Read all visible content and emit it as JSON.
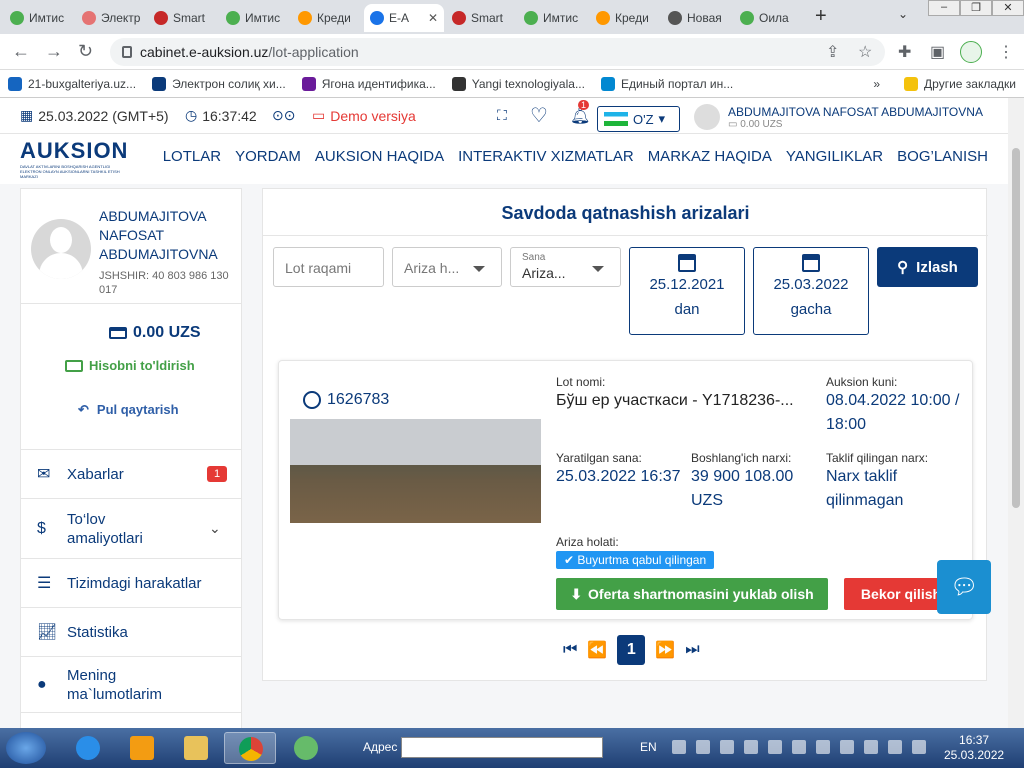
{
  "browser": {
    "tabs": [
      {
        "label": "Имтис",
        "color": "#4caf50"
      },
      {
        "label": "Электр",
        "color": "#e57373"
      },
      {
        "label": "Smart",
        "color": "#c62828"
      },
      {
        "label": "Имтис",
        "color": "#4caf50"
      },
      {
        "label": "Креди",
        "color": "#ff9800"
      },
      {
        "label": "E-A",
        "color": "#1a73e8",
        "active": true
      },
      {
        "label": "Smart",
        "color": "#c62828"
      },
      {
        "label": "Имтис",
        "color": "#4caf50"
      },
      {
        "label": "Креди",
        "color": "#ff9800"
      },
      {
        "label": "Новая",
        "color": "#555555"
      },
      {
        "label": "Оила",
        "color": "#4caf50"
      }
    ],
    "url_host": "cabinet.e-auksion.uz",
    "url_path": "/lot-application",
    "bookmarks": [
      {
        "label": "21-buxgalteriya.uz...",
        "color": "#1565c0"
      },
      {
        "label": "Электрон солиқ хи...",
        "color": "#0b3a7a"
      },
      {
        "label": "Ягона идентифика...",
        "color": "#6a1b9a"
      },
      {
        "label": "Yangi texnologiyala...",
        "color": "#333333"
      },
      {
        "label": "Единый портал ин...",
        "color": "#0288d1"
      }
    ],
    "bookmarks_more": "»",
    "other_bookmarks": "Другие закладки"
  },
  "topinfo": {
    "date": "25.03.2022 (GMT+5)",
    "time": "16:37:42",
    "demo": "Demo versiya",
    "notif_count": "1",
    "lang": "O'Z",
    "user_name": "ABDUMAJITOVA NAFOSAT ABDUMAJITOVNA",
    "user_balance": "0.00 UZS"
  },
  "logo": {
    "text": "AUKSION",
    "sub": "DAVLAT AKTIVLARINI BOSHQARISH AGENTLIGI ELEKTRON ONLAYN AUKSIONLARNI TASHKIL ETISH MARKAZI"
  },
  "nav": [
    "LOTLAR",
    "YORDAM",
    "AUKSION HAQIDA",
    "INTERAKTIV XIZMATLAR",
    "MARKAZ HAQIDA",
    "YANGILIKLAR",
    "BOG’LANISH"
  ],
  "sidebar": {
    "name": "ABDUMAJITOVA NAFOSAT ABDUMAJITOVNA",
    "jshshir": "JSHSHIR: 40 803 986 130 017",
    "balance": "0.00 UZS",
    "topup": "Hisobni to'ldirish",
    "refund": "Pul qaytarish",
    "menu": [
      {
        "label": "Xabarlar",
        "badge": "1"
      },
      {
        "label": "To‘lov amaliyotlari"
      },
      {
        "label": "Tizimdagi harakatlar"
      },
      {
        "label": "Statistika"
      },
      {
        "label": "Mening ma`lumotlarim"
      }
    ]
  },
  "main": {
    "title": "Savdoda qatnashish arizalari",
    "lot_placeholder": "Lot raqami",
    "status_select": "Ariza h...",
    "date_select_label": "Sana",
    "date_select_value": "Ariza...",
    "date_from": "25.12.2021",
    "date_from_suffix": "dan",
    "date_to": "25.03.2022",
    "date_to_suffix": "gacha",
    "search_label": "Izlash"
  },
  "lot": {
    "number": "1626783",
    "name_label": "Lot nomi:",
    "name": "Бўш ер участкаси - Y1718236-...",
    "auction_label": "Auksion kuni:",
    "auction_date": "08.04.2022 10:00 / 18:00",
    "created_label": "Yaratilgan sana:",
    "created": "25.03.2022 16:37",
    "start_price_label": "Boshlang'ich narxi:",
    "start_price": "39 900 108.00 UZS",
    "offer_label": "Taklif qilingan narx:",
    "offer": "Narx taklif qilinmagan",
    "status_label": "Ariza holati:",
    "status": "Buyurtma qabul qilingan",
    "download_label": "Oferta shartnomasini yuklab olish",
    "cancel_label": "Bekor qilish"
  },
  "pager": {
    "current": "1"
  },
  "taskbar": {
    "address_label": "Адрес",
    "lang": "EN",
    "time": "16:37",
    "date": "25.03.2022"
  }
}
